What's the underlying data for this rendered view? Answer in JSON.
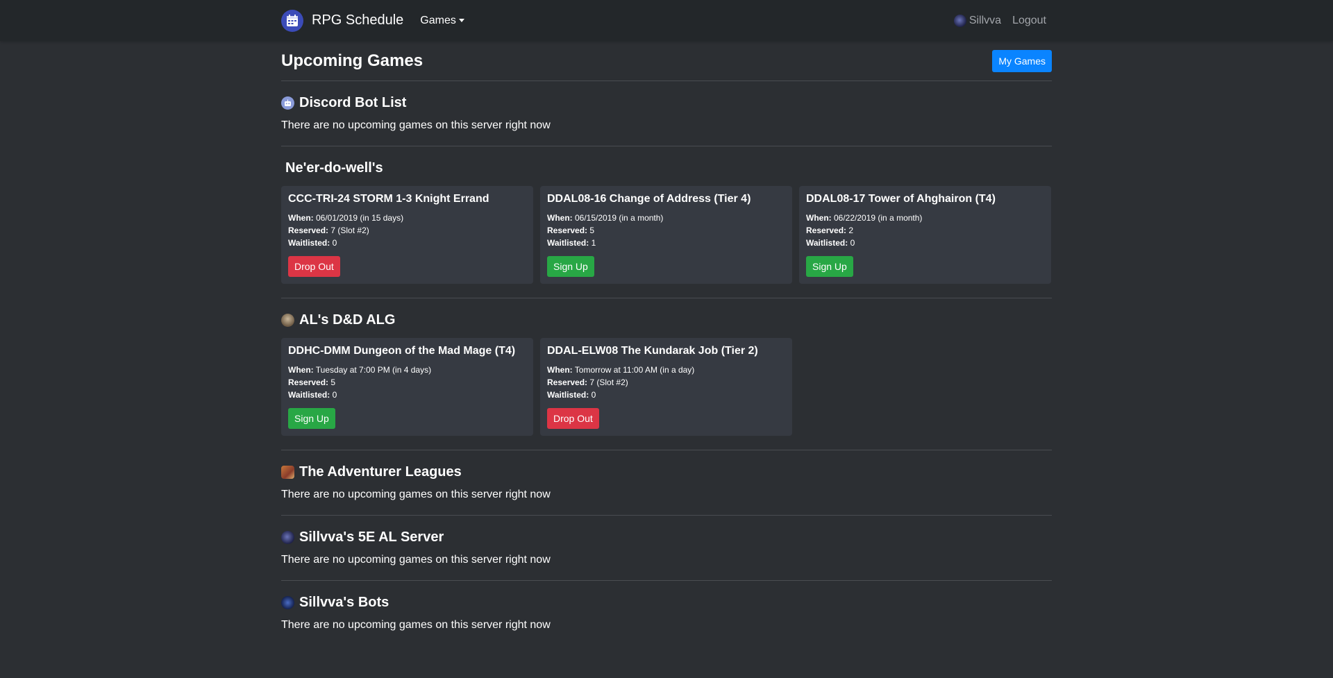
{
  "nav": {
    "brand": "RPG Schedule",
    "games_menu": "Games",
    "user": "Sillvva",
    "logout": "Logout"
  },
  "page": {
    "title": "Upcoming Games",
    "my_games_button": "My Games"
  },
  "labels": {
    "when": "When:",
    "reserved": "Reserved:",
    "waitlisted": "Waitlisted:",
    "empty": "There are no upcoming games on this server right now"
  },
  "servers": [
    {
      "name": "Discord Bot List",
      "icon": "robot-icon"
    },
    {
      "name": "Ne'er-do-well's",
      "games": [
        {
          "title": "CCC-TRI-24 STORM 1-3 Knight Errand",
          "when": "06/01/2019 (in 15 days)",
          "reserved": "7 (Slot #2)",
          "waitlisted": "0",
          "action": "Drop Out"
        },
        {
          "title": "DDAL08-16 Change of Address (Tier 4)",
          "when": "06/15/2019 (in a month)",
          "reserved": "5",
          "waitlisted": "1",
          "action": "Sign Up"
        },
        {
          "title": "DDAL08-17 Tower of Ahghairon (T4)",
          "when": "06/22/2019 (in a month)",
          "reserved": "2",
          "waitlisted": "0",
          "action": "Sign Up"
        }
      ]
    },
    {
      "name": "AL's D&D ALG",
      "icon": "server-avatar-icon",
      "games": [
        {
          "title": "DDHC-DMM Dungeon of the Mad Mage (T4)",
          "when": "Tuesday at 7:00 PM (in 4 days)",
          "reserved": "5",
          "waitlisted": "0",
          "action": "Sign Up"
        },
        {
          "title": "DDAL-ELW08 The Kundarak Job (Tier 2)",
          "when": "Tomorrow at 11:00 AM (in a day)",
          "reserved": "7 (Slot #2)",
          "waitlisted": "0",
          "action": "Drop Out"
        }
      ]
    },
    {
      "name": "The Adventurer Leagues",
      "icon": "server-avatar-icon"
    },
    {
      "name": "Sillvva's 5E AL Server",
      "icon": "server-avatar-icon"
    },
    {
      "name": "Sillvva's Bots",
      "icon": "server-avatar-icon"
    }
  ],
  "colors": {
    "background": "#2c2f33",
    "navbar": "#23272a",
    "card": "#363a42",
    "primary": "#0a84ff",
    "success": "#28a745",
    "danger": "#dc3545"
  }
}
